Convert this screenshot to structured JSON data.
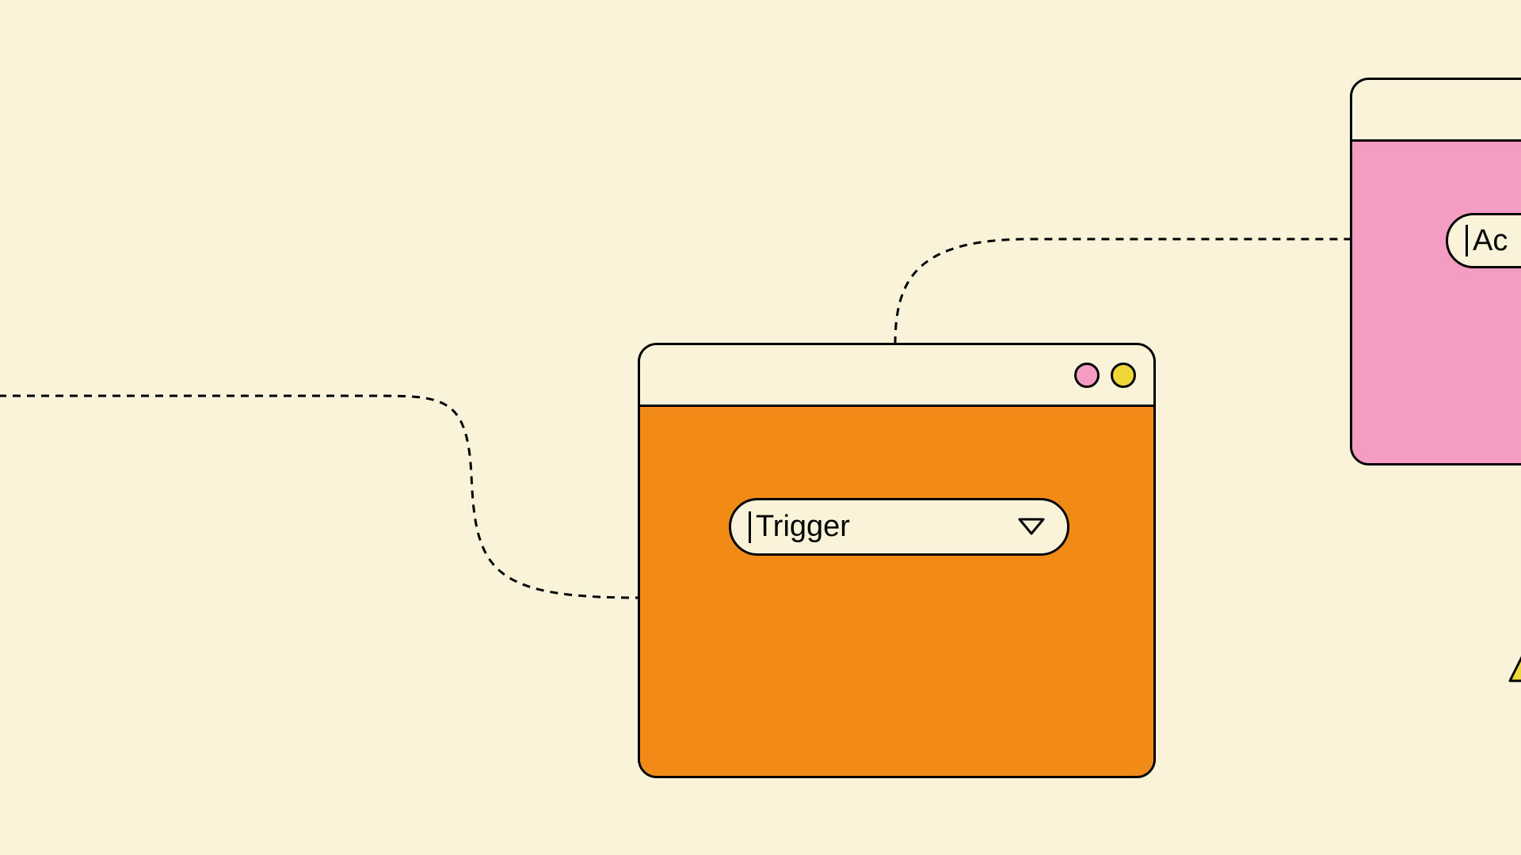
{
  "colors": {
    "background": "#f9f4d9",
    "stroke": "#000000",
    "orange": "#ef8b16",
    "pink": "#f59cc3",
    "yellow": "#f0d738"
  },
  "windows": {
    "trigger": {
      "titlebar_dots": [
        "pink",
        "yellow"
      ],
      "dropdown": {
        "label": "Trigger",
        "has_chevron": true
      }
    },
    "action": {
      "titlebar_dots": [],
      "dropdown": {
        "label": "Ac",
        "has_chevron": false
      }
    }
  },
  "connectors": {
    "style": "dashed"
  }
}
